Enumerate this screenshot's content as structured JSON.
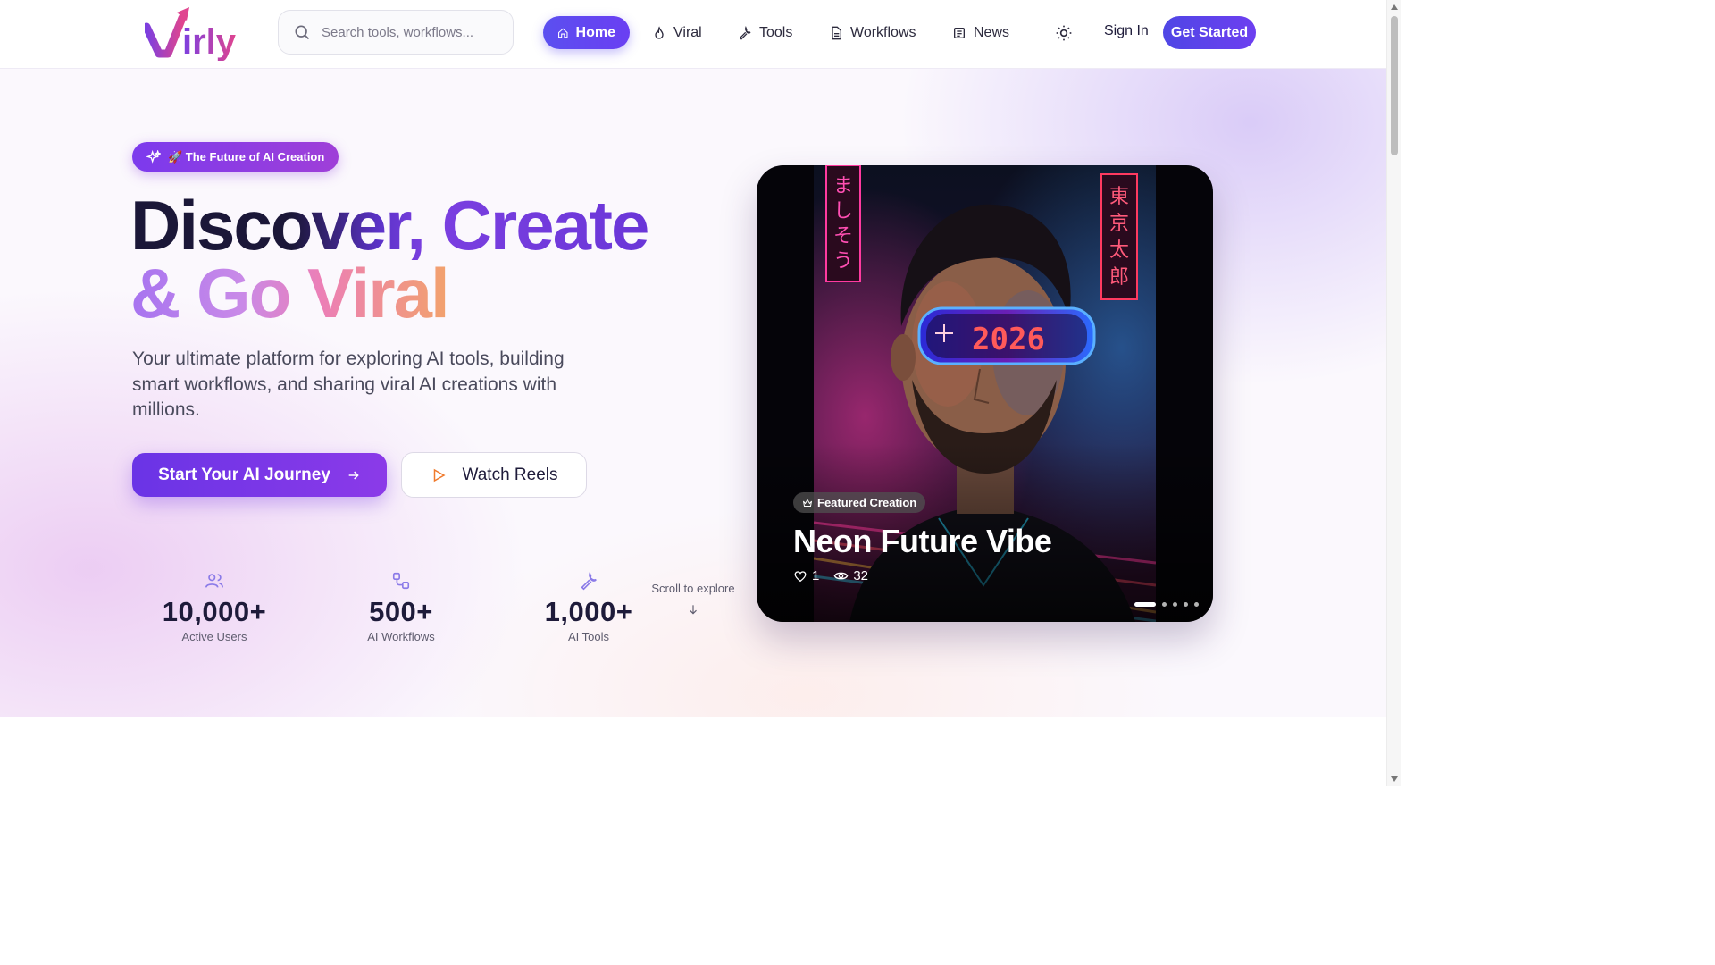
{
  "brand": {
    "logo_text": "Virly"
  },
  "nav": {
    "search_placeholder": "Search tools, workflows...",
    "items": [
      {
        "label": "Home",
        "icon": "home-icon",
        "active": true
      },
      {
        "label": "Viral",
        "icon": "flame-icon",
        "active": false
      },
      {
        "label": "Tools",
        "icon": "wrench-icon",
        "active": false
      },
      {
        "label": "Workflows",
        "icon": "document-icon",
        "active": false
      },
      {
        "label": "News",
        "icon": "newspaper-icon",
        "active": false
      }
    ],
    "theme_icon": "sun-icon",
    "sign_in": "Sign In",
    "get_started": "Get Started"
  },
  "hero": {
    "badge": "🚀 The Future of AI Creation",
    "headline_line1_a": "Discover,",
    "headline_line1_b": "Create",
    "headline_line2": "& Go Viral",
    "subtitle": "Your ultimate platform for exploring AI tools, building smart workflows, and sharing viral AI creations with millions.",
    "cta_primary": "Start Your AI Journey",
    "cta_secondary": "Watch Reels",
    "stats": [
      {
        "value": "10,000+",
        "label": "Active Users",
        "icon": "users-icon"
      },
      {
        "value": "500+",
        "label": "AI Workflows",
        "icon": "workflow-icon"
      },
      {
        "value": "1,000+",
        "label": "AI Tools",
        "icon": "wrench-icon"
      }
    ],
    "scroll_hint": "Scroll to explore"
  },
  "featured": {
    "badge": "Featured Creation",
    "title": "Neon Future Vibe",
    "likes": "1",
    "views": "32",
    "slides_total": 5,
    "active_slide": 1,
    "visor_text": "2026",
    "sign_left": "ましそう",
    "sign_right": "東京太郎"
  },
  "colors": {
    "accent": "#6a34e6",
    "accent_secondary": "#4f46e5",
    "text_dark": "#1e1b3a",
    "muted": "#5e5c6e"
  }
}
